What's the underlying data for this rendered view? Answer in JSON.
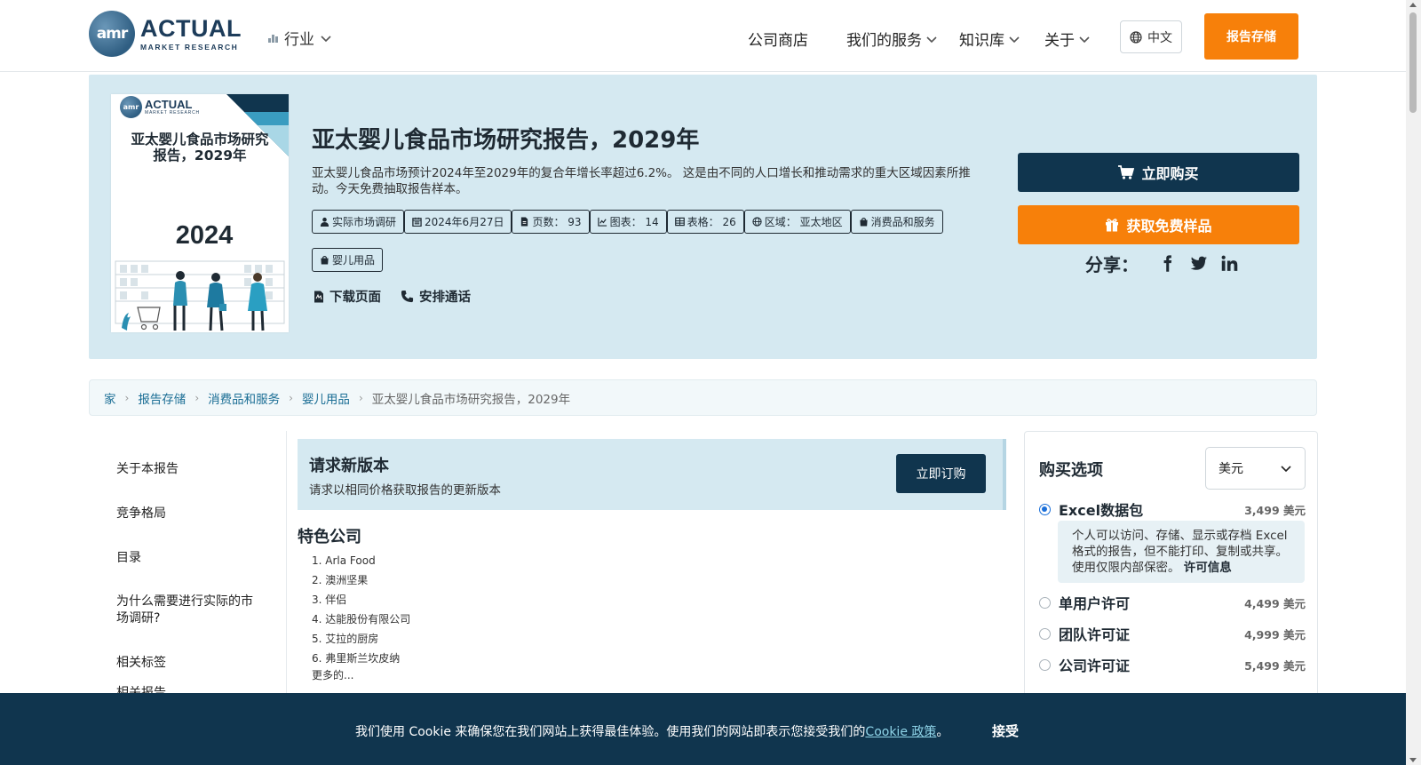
{
  "colors": {
    "brand_navy": "#10354e",
    "brand_orange": "#f7800a",
    "hero_bg": "#d5e9f1",
    "link": "#1b6e95"
  },
  "header": {
    "logo_word": "ACTUAL",
    "logo_sub": "MARKET RESEARCH",
    "logo_mark": "amr",
    "industry_label": "行业",
    "nav": [
      "公司商店",
      "我们的服务",
      "知识库",
      "关于"
    ],
    "language": "中文",
    "store_button": "报告存储"
  },
  "hero": {
    "cover": {
      "logo_word": "ACTUAL",
      "logo_sub": "MARKET RESEARCH",
      "title": "亚太婴儿食品市场研究报告，2029年",
      "year": "2024"
    },
    "title": "亚太婴儿食品市场研究报告，2029年",
    "description": "亚太婴儿食品市场预计2024年至2029年的复合年增长率超过6.2%。 这是由不同的人口增长和推动需求的重大区域因素所推动。今天免费抽取报告样本。",
    "tags": [
      {
        "icon": "user-icon",
        "text": "实际市场调研"
      },
      {
        "icon": "calendar-icon",
        "text": "2024年6月27日"
      },
      {
        "icon": "pages-icon",
        "text": "页数： 93"
      },
      {
        "icon": "chart-icon",
        "text": "图表： 14"
      },
      {
        "icon": "table-icon",
        "text": "表格： 26"
      },
      {
        "icon": "globe-icon",
        "text": "区域： 亚太地区"
      },
      {
        "icon": "bag-icon",
        "text": "消费品和服务"
      },
      {
        "icon": "bag-icon",
        "text": "婴儿用品"
      }
    ],
    "download_label": "下载页面",
    "schedule_label": "安排通话",
    "buy_now": "立即购买",
    "free_sample": "获取免费样品",
    "share_label": "分享："
  },
  "breadcrumb": [
    "家",
    "报告存储",
    "消费品和服务",
    "婴儿用品",
    "亚太婴儿食品市场研究报告，2029年"
  ],
  "sidebar": {
    "items": [
      "关于本报告",
      "竞争格局",
      "目录",
      "为什么需要进行实际的市场调研?",
      "相关标签",
      "相关报告"
    ]
  },
  "request": {
    "title": "请求新版本",
    "subtitle": "请求以相同价格获取报告的更新版本",
    "button": "立即订购"
  },
  "featured": {
    "title": "特色公司",
    "companies": [
      "1. Arla Food",
      "2. 澳洲坚果",
      "3. 伴侣",
      "4. 达能股份有限公司",
      "5. 艾拉的厨房",
      "6. 弗里斯兰坎皮纳"
    ],
    "more": "更多的..."
  },
  "purchase": {
    "title": "购买选项",
    "currency": "美元",
    "options": [
      {
        "label": "Excel数据包",
        "price": "3,499 美元",
        "selected": true
      },
      {
        "label": "单用户许可",
        "price": "4,499 美元",
        "selected": false
      },
      {
        "label": "团队许可证",
        "price": "4,999 美元",
        "selected": false
      },
      {
        "label": "公司许可证",
        "price": "5,499 美元",
        "selected": false
      }
    ],
    "excel_desc": "个人可以访问、存储、显示或存档 Excel 格式的报告，但不能打印、复制或共享。使用仅限内部保密。",
    "excel_license_link": "许可信息"
  },
  "cookie": {
    "text": "我们使用 Cookie 来确保您在我们网站上获得最佳体验。使用我们的网站即表示您接受我们的",
    "link": "Cookie 政策",
    "period": "。",
    "accept": "接受"
  }
}
